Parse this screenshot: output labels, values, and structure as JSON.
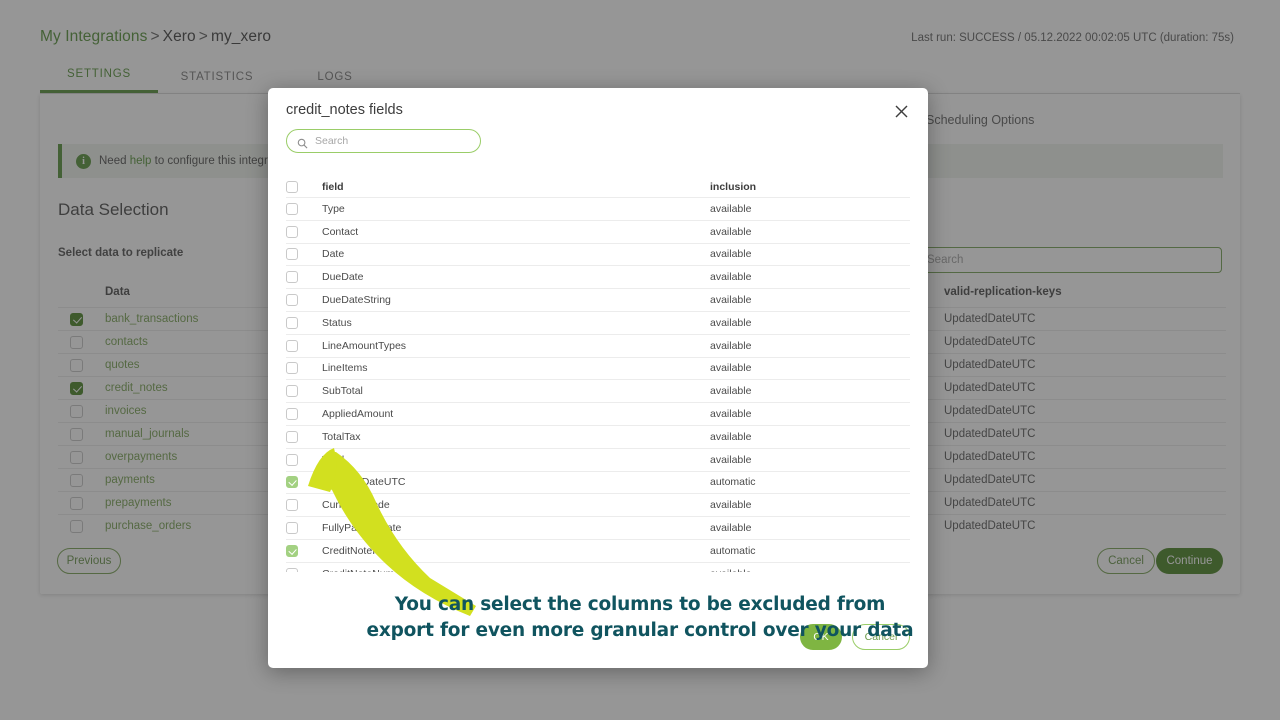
{
  "background": {
    "breadcrumb": {
      "root": "My Integrations",
      "sep1": ">",
      "level2": "Xero",
      "sep2": ">",
      "level3": "my_xero"
    },
    "last_run": "Last run: SUCCESS / 05.12.2022 00:02:05 UTC (duration: 75s)",
    "tabs": [
      {
        "label": "SETTINGS",
        "active": true
      },
      {
        "label": "STATISTICS",
        "active": false
      },
      {
        "label": "LOGS",
        "active": false
      }
    ],
    "help_banner": {
      "icon": "info-icon",
      "prefix": "Need ",
      "link": "help",
      "suffix": " to configure this integration?"
    },
    "section_title": "Data Selection",
    "subtitle": "Select data to replicate",
    "scheduling_title": "Scheduling Options",
    "search_placeholder": "Search",
    "data_table": {
      "header": "Data",
      "rows": [
        {
          "label": "bank_transactions",
          "checked": true
        },
        {
          "label": "contacts",
          "checked": false
        },
        {
          "label": "quotes",
          "checked": false
        },
        {
          "label": "credit_notes",
          "checked": true
        },
        {
          "label": "invoices",
          "checked": false
        },
        {
          "label": "manual_journals",
          "checked": false
        },
        {
          "label": "overpayments",
          "checked": false
        },
        {
          "label": "payments",
          "checked": false
        },
        {
          "label": "prepayments",
          "checked": false
        },
        {
          "label": "purchase_orders",
          "checked": false
        }
      ]
    },
    "keys_table": {
      "header": "valid-replication-keys",
      "rows": [
        "UpdatedDateUTC",
        "UpdatedDateUTC",
        "UpdatedDateUTC",
        "UpdatedDateUTC",
        "UpdatedDateUTC",
        "UpdatedDateUTC",
        "UpdatedDateUTC",
        "UpdatedDateUTC",
        "UpdatedDateUTC",
        "UpdatedDateUTC"
      ]
    },
    "buttons": {
      "previous": "Previous",
      "cancel": "Cancel",
      "continue": "Continue"
    }
  },
  "modal": {
    "title": "credit_notes fields",
    "close_icon": "close-icon",
    "search_placeholder": "Search",
    "search_value": "",
    "columns": {
      "field": "field",
      "inclusion": "inclusion"
    },
    "select_all_checked": false,
    "rows": [
      {
        "field": "Type",
        "inclusion": "available",
        "checked": false
      },
      {
        "field": "Contact",
        "inclusion": "available",
        "checked": false
      },
      {
        "field": "Date",
        "inclusion": "available",
        "checked": false
      },
      {
        "field": "DueDate",
        "inclusion": "available",
        "checked": false
      },
      {
        "field": "DueDateString",
        "inclusion": "available",
        "checked": false
      },
      {
        "field": "Status",
        "inclusion": "available",
        "checked": false
      },
      {
        "field": "LineAmountTypes",
        "inclusion": "available",
        "checked": false
      },
      {
        "field": "LineItems",
        "inclusion": "available",
        "checked": false
      },
      {
        "field": "SubTotal",
        "inclusion": "available",
        "checked": false
      },
      {
        "field": "AppliedAmount",
        "inclusion": "available",
        "checked": false
      },
      {
        "field": "TotalTax",
        "inclusion": "available",
        "checked": false
      },
      {
        "field": "Total",
        "inclusion": "available",
        "checked": false
      },
      {
        "field": "UpdatedDateUTC",
        "inclusion": "automatic",
        "checked": true
      },
      {
        "field": "CurrencyCode",
        "inclusion": "available",
        "checked": false
      },
      {
        "field": "FullyPaidOnDate",
        "inclusion": "available",
        "checked": false
      },
      {
        "field": "CreditNoteID",
        "inclusion": "automatic",
        "checked": true
      },
      {
        "field": "CreditNoteNumber",
        "inclusion": "available",
        "checked": false
      }
    ],
    "buttons": {
      "ok": "OK",
      "cancel": "Cancel"
    }
  },
  "annotation": {
    "arrow_icon": "curved-arrow-icon",
    "arrow_color": "#d2e01f",
    "caption_line1": "You can select the columns to be excluded from",
    "caption_line2": "export for even more granular control over your data",
    "caption_color": "#10545f"
  },
  "colors": {
    "brand_green": "#4a8a2b",
    "dark_green": "#3c7a15",
    "light_green": "#a3d182",
    "ok_green": "#7fb542",
    "overlay": "rgba(64,64,64,.55)"
  }
}
